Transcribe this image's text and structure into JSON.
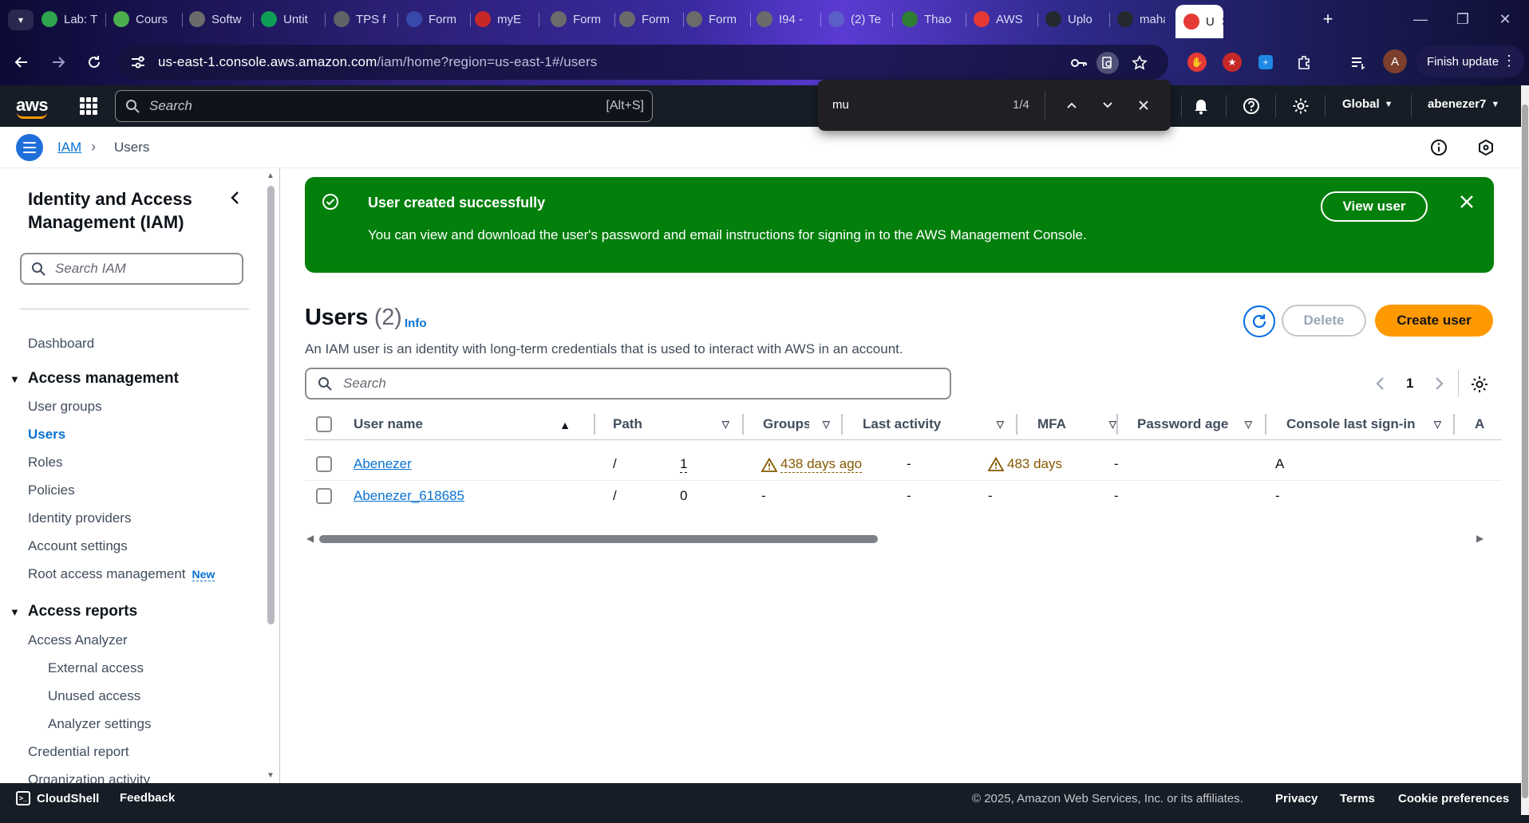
{
  "browser": {
    "tabs": [
      {
        "label": "Lab: T",
        "color": "#2ea44f"
      },
      {
        "label": "Cours",
        "color": "#4caf50"
      },
      {
        "label": "Softw",
        "color": "#6b6b6b"
      },
      {
        "label": "Untit",
        "color": "#0f9d58"
      },
      {
        "label": "TPS f",
        "color": "#5f6368"
      },
      {
        "label": "Form",
        "color": "#3949ab"
      },
      {
        "label": "myE",
        "color": "#c62828"
      },
      {
        "label": "Form",
        "color": "#6b6b6b"
      },
      {
        "label": "Form",
        "color": "#6b6b6b"
      },
      {
        "label": "Form",
        "color": "#6b6b6b"
      },
      {
        "label": "I94 -",
        "color": "#6b6b6b"
      },
      {
        "label": "(2) Te",
        "color": "#5b5fc7"
      },
      {
        "label": "Thao",
        "color": "#2e7d32"
      },
      {
        "label": "AWS",
        "color": "#e53935"
      },
      {
        "label": "Uplo",
        "color": "#24292f"
      },
      {
        "label": "maha",
        "color": "#24292f"
      },
      {
        "label": "U",
        "color": "#e53935"
      }
    ],
    "url_host": "us-east-1.console.aws.amazon.com",
    "url_path": "/iam/home?region=us-east-1#/users",
    "profile_initial": "A",
    "finish_update_label": "Finish update"
  },
  "find_bar": {
    "query": "mu",
    "count": "1/4"
  },
  "aws_nav": {
    "logo": "aws",
    "search_placeholder": "Search",
    "search_shortcut": "[Alt+S]",
    "region": "Global",
    "account": "abenezer7"
  },
  "breadcrumb": {
    "items": [
      "IAM",
      "Users"
    ]
  },
  "sidebar": {
    "title": "Identity and Access Management (IAM)",
    "search_placeholder": "Search IAM",
    "dashboard": "Dashboard",
    "sections": [
      {
        "title": "Access management",
        "items": [
          "User groups",
          "Users",
          "Roles",
          "Policies",
          "Identity providers",
          "Account settings",
          "Root access management"
        ],
        "new_badge": "New"
      },
      {
        "title": "Access reports",
        "items": [
          "Access Analyzer",
          "External access",
          "Unused access",
          "Analyzer settings",
          "Credential report",
          "Organization activity"
        ]
      }
    ]
  },
  "flash": {
    "title": "User created successfully",
    "message": "You can view and download the user's password and email instructions for signing in to the AWS Management Console.",
    "view_button": "View user"
  },
  "users": {
    "heading": "Users",
    "count": "(2)",
    "info": "Info",
    "description": "An IAM user is an identity with long-term credentials that is used to interact with AWS in an account.",
    "delete_label": "Delete",
    "create_label": "Create user",
    "search_placeholder": "Search",
    "page": "1",
    "columns": [
      "User name",
      "Path",
      "Groups",
      "Last activity",
      "MFA",
      "Password age",
      "Console last sign-in",
      "A"
    ],
    "rows": [
      {
        "user_name": "Abenezer",
        "path": "/",
        "groups": "1",
        "last_activity": "438 days ago",
        "mfa": "-",
        "password_age": "483 days",
        "console_last_signin": "-",
        "access": "A"
      },
      {
        "user_name": "Abenezer_618685",
        "path": "/",
        "groups": "0",
        "last_activity": "-",
        "mfa": "-",
        "password_age": "-",
        "console_last_signin": "-",
        "access": "-"
      }
    ]
  },
  "footer": {
    "cloudshell": "CloudShell",
    "feedback": "Feedback",
    "copyright": "© 2025, Amazon Web Services, Inc. or its affiliates.",
    "privacy": "Privacy",
    "terms": "Terms",
    "cookie": "Cookie preferences"
  },
  "colors": {
    "success": "#037f0c",
    "primary_button": "#ff9900",
    "link": "#0972d3",
    "warning": "#855900",
    "nav_bg": "#161d26"
  }
}
